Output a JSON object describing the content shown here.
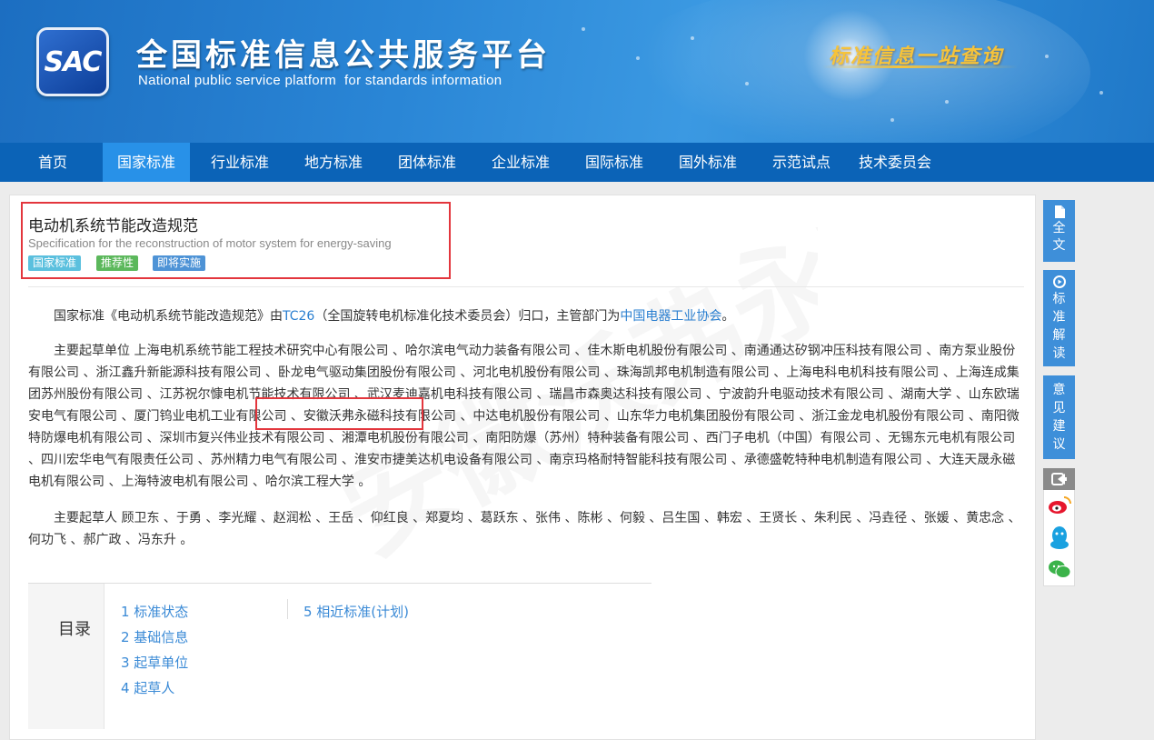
{
  "header": {
    "logo_text": "SAC",
    "title": "全国标准信息公共服务平台",
    "subtitle": "National public service platform  for standards information",
    "slogan": "标准信息一站查询"
  },
  "nav": {
    "items": [
      "首页",
      "国家标准",
      "行业标准",
      "地方标准",
      "团体标准",
      "企业标准",
      "国际标准",
      "国外标准",
      "示范试点",
      "技术委员会"
    ],
    "active": "国家标准"
  },
  "standard": {
    "title": "电动机系统节能改造规范",
    "title_en": "Specification for the reconstruction of motor system for energy-saving",
    "badges": [
      "国家标准",
      "推荐性",
      "即将实施"
    ]
  },
  "intro": {
    "prefix": "国家标准《电动机系统节能改造规范》由",
    "tc_link": "TC26",
    "middle": "（全国旋转电机标准化技术委员会）归口，主管部门为",
    "dept_link": "中国电器工业协会",
    "suffix": "。"
  },
  "drafting_units": {
    "label": "主要起草单位",
    "part1": "上海电机系统节能工程技术研究中心有限公司 、哈尔滨电气动力装备有限公司 、佳木斯电机股份有限公司 、南通通达矽钢冲压科技有限公司 、南方泵业股份有限公司 、浙江鑫升新能源科技有限公司 、卧龙电气驱动集团股份有限公司 、河北电机股份有限公司 、珠海凯邦电机制造有限公司 、上海电科电机科技有限公司 、上海连成集团苏州股份有限公司 、江苏祝尔慷电机节能技术有限公司 、武汉麦迪嘉机电科技有限公司 、瑞昌市森奥达科技有限公司 、宁波韵升电驱动技术有限公司 、湖南大学 、山东欧瑞安电气有限公司 、厦门钨业电机工业有限公司 、",
    "highlight": "安徽沃弗永磁科技有限公司",
    "part2": " 、中达电机股份有限公司 、山东华力电机集团股份有限公司 、浙江金龙电机股份有限公司 、南阳微特防爆电机有限公司 、深圳市复兴伟业技术有限公司 、湘潭电机股份有限公司 、南阳防爆（苏州）特种装备有限公司 、西门子电机（中国）有限公司 、无锡东元电机有限公司 、四川宏华电气有限责任公司 、苏州精力电气有限公司 、淮安市捷美达机电设备有限公司 、南京玛格耐特智能科技有限公司 、承德盛乾特种电机制造有限公司 、大连天晟永磁电机有限公司 、上海特波电机有限公司 、哈尔滨工程大学 。"
  },
  "drafters": {
    "label": "主要起草人",
    "names": "顾卫东 、于勇 、李光耀 、赵润松 、王岳 、仰红良 、郑夏均 、葛跃东 、张伟 、陈彬 、何毅 、吕生国 、韩宏 、王贤长 、朱利民 、冯垚径 、张媛 、黄忠念 、何功飞 、郝广政 、冯东升 。"
  },
  "toc": {
    "label": "目录",
    "items": [
      "1  标准状态",
      "2  基础信息",
      "3  起草单位",
      "4  起草人",
      "5  相近标准(计划)"
    ]
  },
  "side_tools": {
    "full_text": "全文",
    "interpret": "标准解读",
    "feedback": "意见建议"
  },
  "watermark": "安徽沃弗永磁",
  "colors": {
    "nav_bg": "#0b63b7",
    "nav_active": "#2891e8",
    "link": "#2a7fd0",
    "highlight_border": "#e3363d",
    "slogan": "#f6c33a"
  }
}
